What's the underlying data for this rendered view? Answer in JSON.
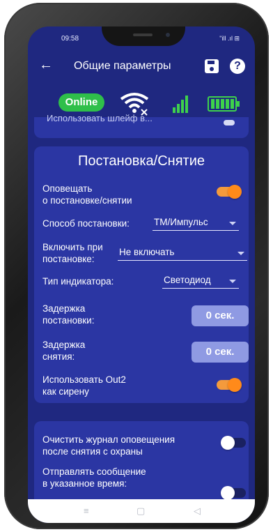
{
  "status_bar": {
    "time": "09:58",
    "signal_text": "\"ill .ıl ⊞"
  },
  "app_bar": {
    "title": "Общие параметры"
  },
  "indicators": {
    "online_label": "Online"
  },
  "previous_section": {
    "cut_text": "Использовать шлейф в..."
  },
  "arming_section": {
    "title": "Постановка/Снятие",
    "notify_label": "Оповещать\nо постановке/снятии",
    "arming_method_label": "Способ постановки:",
    "arming_method_value": "ТМ/Импульс",
    "enable_on_arm_label": "Включить при\nпостановке:",
    "enable_on_arm_value": "Не включать",
    "indicator_type_label": "Тип индикатора:",
    "indicator_type_value": "Светодиод",
    "arm_delay_label": "Задержка\nпостановки:",
    "arm_delay_value": "0 сек.",
    "disarm_delay_label": "Задержка\nснятия:",
    "disarm_delay_value": "0 сек.",
    "out2_siren_label": "Использовать Out2\nкак сирену"
  },
  "notifications_section": {
    "clear_log_label": "Очистить журнал оповещения\nпосле снятия с охраны",
    "send_at_time_label": "Отправлять сообщение\nв указанное время:"
  },
  "toggles": {
    "notify_arming": true,
    "out2_siren": true,
    "clear_log": false,
    "send_at_time": false
  },
  "colors": {
    "screen_bg": "#1f2880",
    "card_bg": "#2b36a3",
    "online_green": "#2fbf4a",
    "toggle_on": "#ff8a1a",
    "pill_bg": "#8f9ae3"
  }
}
